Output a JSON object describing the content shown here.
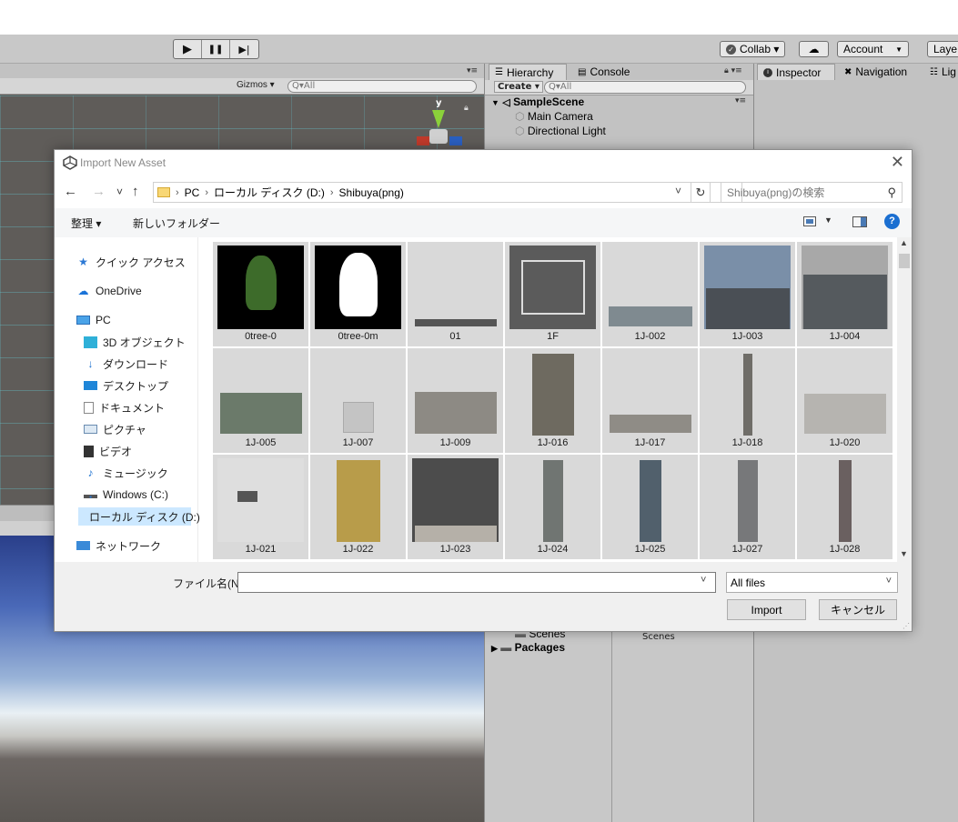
{
  "unity": {
    "toolbar": {
      "play_icon": "▶",
      "pause_icon": "❚❚",
      "step_icon": "▶|",
      "collab": "Collab ▾",
      "account": "Account",
      "layers": "Laye"
    },
    "scene": {
      "gizmos": "Gizmos ▾",
      "search": "Q▾All",
      "gizmo_axis": "y",
      "tab_menu": "▾≡"
    },
    "hierarchy": {
      "tab": "Hierarchy",
      "console_tab": "Console",
      "create": "Create ▾",
      "search": "Q▾All",
      "scene_name": "SampleScene",
      "items": [
        "Main Camera",
        "Directional Light"
      ]
    },
    "inspector": {
      "tab": "Inspector",
      "navigation_tab": "Navigation",
      "lighting_tab": "Lig",
      "lock_icon": "lock-icon"
    },
    "project": {
      "folders": [
        "Scenes",
        "Packages"
      ],
      "right_folder": "Scenes"
    }
  },
  "dialog": {
    "title": "Import New Asset",
    "close": "✕",
    "nav": {
      "back": "←",
      "forward": "→",
      "recent": "˅",
      "up": "↑"
    },
    "breadcrumb": [
      "PC",
      "ローカル ディスク (D:)",
      "Shibuya(png)"
    ],
    "address_dropdown": "˅",
    "refresh": "↻",
    "search_placeholder": "Shibuya(png)の検索",
    "commands": {
      "organize": "整理 ▾",
      "new_folder": "新しいフォルダー",
      "help": "?"
    },
    "nav_pane": [
      {
        "label": "クイック アクセス",
        "icon": "star-icon"
      },
      {
        "label": "OneDrive",
        "icon": "cloud-icon"
      },
      {
        "label": "PC",
        "icon": "pc-icon"
      },
      {
        "label": "3D オブジェクト",
        "icon": "cube-icon"
      },
      {
        "label": "ダウンロード",
        "icon": "download-icon"
      },
      {
        "label": "デスクトップ",
        "icon": "desktop-icon"
      },
      {
        "label": "ドキュメント",
        "icon": "document-icon"
      },
      {
        "label": "ピクチャ",
        "icon": "pictures-icon"
      },
      {
        "label": "ビデオ",
        "icon": "video-icon"
      },
      {
        "label": "ミュージック",
        "icon": "music-icon"
      },
      {
        "label": "Windows (C:)",
        "icon": "drive-icon"
      },
      {
        "label": "ローカル ディスク (D:)",
        "icon": "drive-icon"
      },
      {
        "label": "ネットワーク",
        "icon": "network-icon"
      }
    ],
    "files": [
      "0tree-0",
      "0tree-0m",
      "01",
      "1F",
      "1J-002",
      "1J-003",
      "1J-004",
      "1J-005",
      "1J-007",
      "1J-009",
      "1J-016",
      "1J-017",
      "1J-018",
      "1J-020",
      "1J-021",
      "1J-022",
      "1J-023",
      "1J-024",
      "1J-025",
      "1J-027",
      "1J-028"
    ],
    "filename_label": "ファイル名(N):",
    "filename_value": "",
    "filetype": "All files",
    "import_button": "Import",
    "cancel_button": "キャンセル"
  }
}
